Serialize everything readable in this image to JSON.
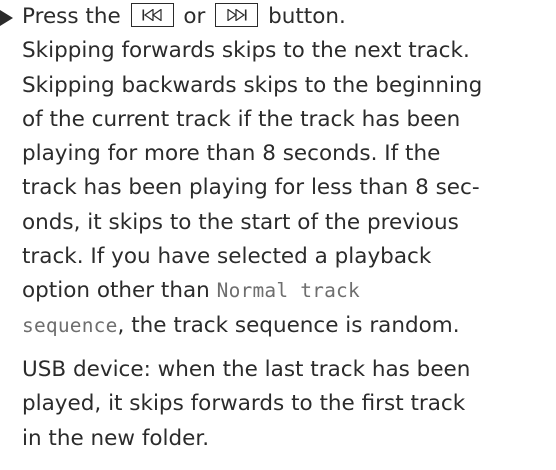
{
  "step": {
    "press_prefix": "Press the",
    "prev_button_icon": "skip-backward-icon",
    "or_word": "or",
    "next_button_icon": "skip-forward-icon",
    "press_suffix": "button."
  },
  "paragraph1": {
    "l1": "Skipping forwards skips to the next track.",
    "l2": "Skipping backwards skips to the beginning",
    "l3": "of the current track if the track has been",
    "l4": "playing for more than 8 seconds. If the",
    "l5": "track has been playing for less than 8 sec-",
    "l6": "onds, it skips to the start of the previous",
    "l7": "track. If you have selected a playback",
    "l8_prefix": "option other than",
    "option_name_part1": "Normal track",
    "option_name_part2": "sequence",
    "l9_suffix": ", the track sequence is random."
  },
  "paragraph2": {
    "l1": "USB device: when the last track has been",
    "l2": "played, it skips forwards to the first track",
    "l3": "in the new folder."
  }
}
